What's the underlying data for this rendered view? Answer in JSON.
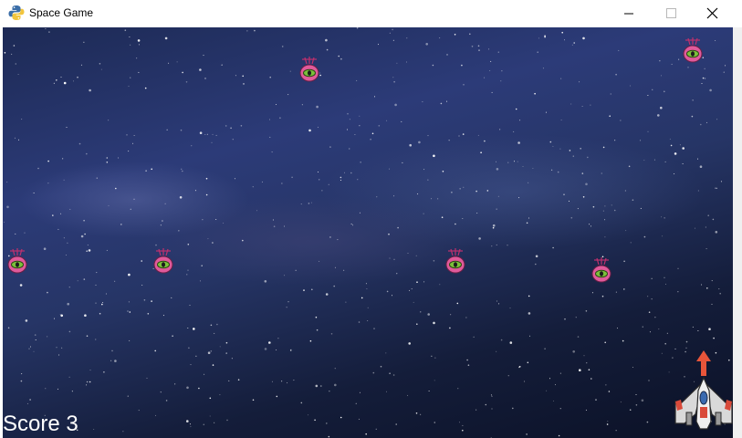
{
  "window": {
    "title": "Space Game",
    "app_icon": "python-icon",
    "controls": [
      "minimize-icon",
      "maximize-icon",
      "close-icon"
    ]
  },
  "game": {
    "score_text": "Score 3",
    "player_icon": "spaceship-icon",
    "bullet_icon": "bullet-arrow-icon",
    "enemy_icon": "alien-enemy-icon",
    "enemy_count": 6,
    "colors": {
      "enemy_body": "#e05a9b",
      "enemy_eye": "#7bbf3a",
      "bullet": "#e8553a",
      "score_text": "#ffffff"
    }
  }
}
